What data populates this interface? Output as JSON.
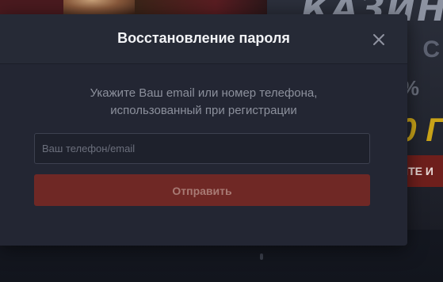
{
  "modal": {
    "title": "Восстановление пароля",
    "instruction_line1": "Укажите Ваш email или номер телефона,",
    "instruction_line2": "использованный при регистрации",
    "input_placeholder": "Ваш телефон/email",
    "input_value": "",
    "submit_label": "Отправить",
    "close_icon": "close-icon"
  },
  "background": {
    "promo_title": "КАЗИН",
    "promo_line1": "С",
    "promo_line2": "%",
    "promo_amount": "0 Г",
    "promo_button": "ЙТЕ И"
  },
  "colors": {
    "modal_bg": "#232633",
    "submit_button": "#6f2825",
    "promo_accent": "#c9a318"
  }
}
